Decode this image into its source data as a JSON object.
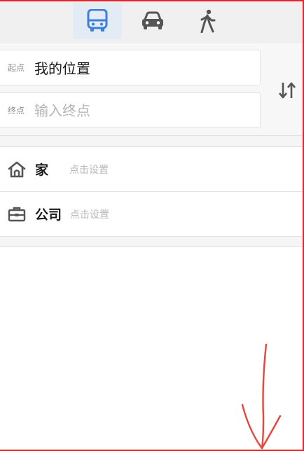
{
  "modes": {
    "active": "bus",
    "items": [
      {
        "id": "bus",
        "icon": "bus-icon",
        "color": "#3d7fd9"
      },
      {
        "id": "car",
        "icon": "car-icon",
        "color": "#555555"
      },
      {
        "id": "walk",
        "icon": "walk-icon",
        "color": "#555555"
      }
    ]
  },
  "route": {
    "start_label": "起点",
    "start_value": "我的位置",
    "end_label": "终点",
    "end_placeholder": "输入终点",
    "end_value": ""
  },
  "favorites": [
    {
      "name": "家",
      "hint": "点击设置",
      "icon": "home-icon"
    },
    {
      "name": "公司",
      "hint": "点击设置",
      "icon": "briefcase-icon"
    }
  ],
  "colors": {
    "accent": "#3d7fd9",
    "annotation": "#e8453c"
  }
}
